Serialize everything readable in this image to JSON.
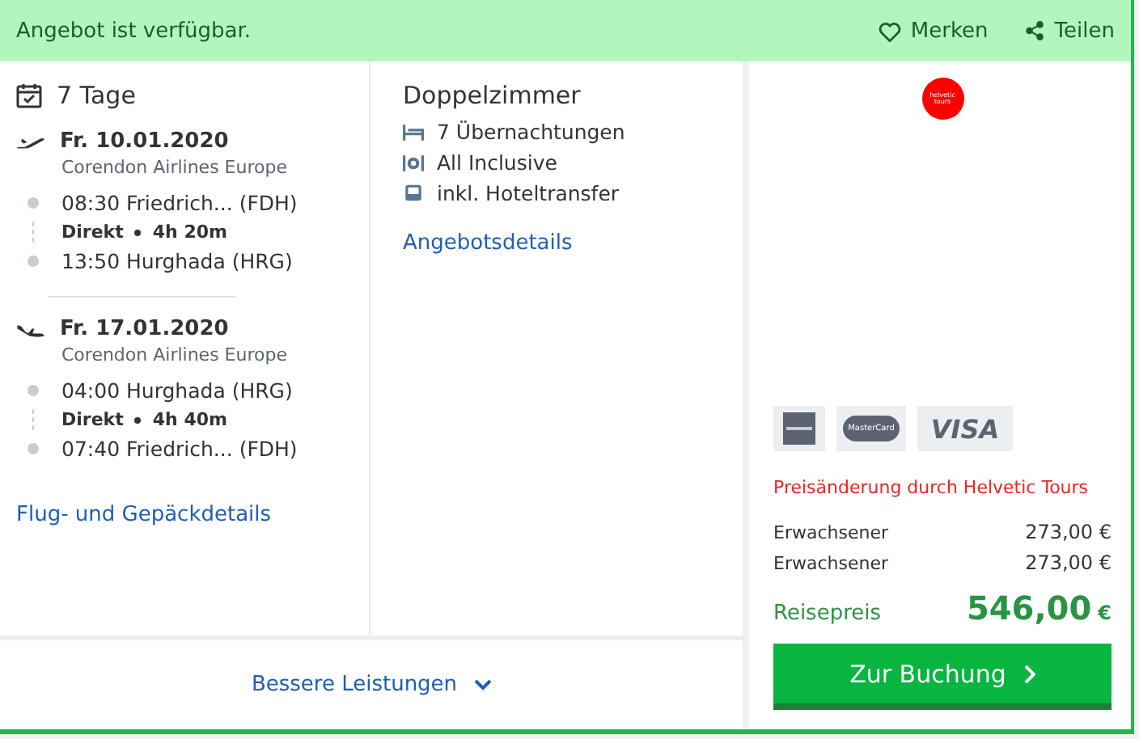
{
  "banner": {
    "status": "Angebot ist verfügbar.",
    "actions": [
      {
        "kind": "heart",
        "label": "Merken"
      },
      {
        "kind": "share",
        "label": "Teilen"
      }
    ]
  },
  "trip": {
    "duration": "7 Tage",
    "flights": [
      {
        "kind": "outbound",
        "date": "Fr. 10.01.2020",
        "airline": "Corendon Airlines Europe",
        "departure": "08:30 Friedrich... (FDH)",
        "stops": "Direkt",
        "duration": "4h 20m",
        "arrival": "13:50 Hurghada (HRG)"
      },
      {
        "kind": "return",
        "date": "Fr. 17.01.2020",
        "airline": "Corendon Airlines Europe",
        "departure": "04:00 Hurghada (HRG)",
        "stops": "Direkt",
        "duration": "4h 40m",
        "arrival": "07:40 Friedrich... (FDH)"
      }
    ],
    "details_link": "Flug- und Gepäckdetails"
  },
  "room": {
    "title": "Doppelzimmer",
    "features": [
      {
        "kind": "bed",
        "label": "7 Übernachtungen"
      },
      {
        "kind": "meal",
        "label": "All Inclusive"
      },
      {
        "kind": "bus",
        "label": "inkl. Hoteltransfer"
      }
    ],
    "details_link": "Angebotsdetails"
  },
  "more_link": "Bessere Leistungen",
  "booking": {
    "logo_text": "helvetic tours",
    "payment_methods": [
      {
        "kind": "amex"
      },
      {
        "kind": "mastercard",
        "label": "MasterCard"
      },
      {
        "kind": "visa",
        "label": "VISA"
      }
    ],
    "notice": "Preisänderung durch Helvetic Tours",
    "travellers": [
      {
        "label": "Erwachsener",
        "price": "273,00 €"
      },
      {
        "label": "Erwachsener",
        "price": "273,00 €"
      }
    ],
    "total_label": "Reisepreis",
    "total_amount": "546,00",
    "total_currency": "€",
    "button": "Zur Buchung"
  }
}
